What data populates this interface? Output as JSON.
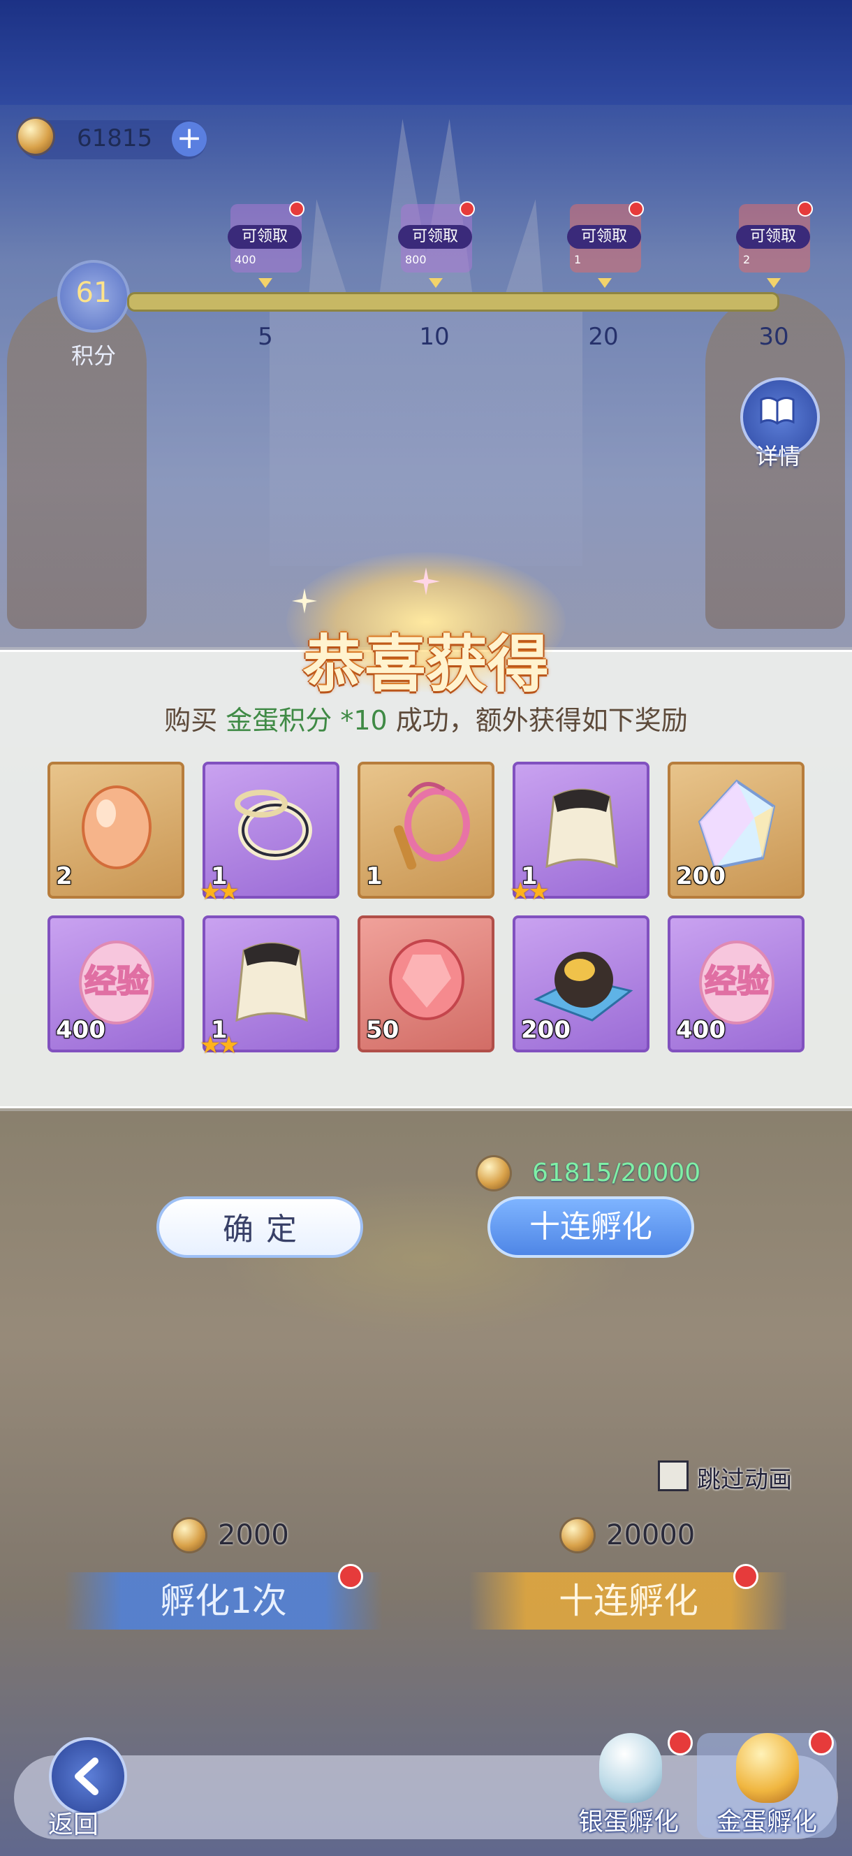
{
  "hud": {
    "gold_coin_balance": "61815",
    "add_label": "+",
    "points_value": "61",
    "points_label": "积分",
    "detail_label": "详情"
  },
  "milestones": [
    {
      "status": "可领取",
      "reward": "400",
      "threshold": "5"
    },
    {
      "status": "可领取",
      "reward": "800",
      "threshold": "10"
    },
    {
      "status": "可领取",
      "reward": "1",
      "threshold": "20"
    },
    {
      "status": "可领取",
      "reward": "2",
      "threshold": "30"
    }
  ],
  "popup": {
    "title": "恭喜获得",
    "msg_prefix": "购买 ",
    "msg_item": "金蛋积分 *10",
    "msg_suffix": " 成功，额外获得如下奖励",
    "rewards": [
      {
        "icon": "orange-egg-icon",
        "count": "2",
        "rarity": "gold",
        "stars": ""
      },
      {
        "icon": "bracelet-icon",
        "count": "1",
        "rarity": "purple",
        "stars": "★★"
      },
      {
        "icon": "whip-icon",
        "count": "1",
        "rarity": "gold",
        "stars": ""
      },
      {
        "icon": "cape-icon",
        "count": "1",
        "rarity": "purple",
        "stars": "★★"
      },
      {
        "icon": "crystal-icon",
        "count": "200",
        "rarity": "gold",
        "stars": ""
      },
      {
        "icon": "exp-egg-icon",
        "count": "400",
        "rarity": "purple",
        "stars": "",
        "text": "经验"
      },
      {
        "icon": "cape-icon",
        "count": "1",
        "rarity": "purple",
        "stars": "★★"
      },
      {
        "icon": "red-gem-icon",
        "count": "50",
        "rarity": "red",
        "stars": ""
      },
      {
        "icon": "gold-ore-icon",
        "count": "200",
        "rarity": "purple",
        "stars": ""
      },
      {
        "icon": "exp-egg-icon",
        "count": "400",
        "rarity": "purple",
        "stars": "",
        "text": "经验"
      }
    ]
  },
  "buttons": {
    "confirm": "确定",
    "ten_hatch": "十连孵化",
    "gold_need": "61815/20000"
  },
  "lower": {
    "skip_label": "跳过动画",
    "cost_single": "2000",
    "cost_ten": "20000",
    "hatch_single": "孵化1次",
    "hatch_ten": "十连孵化"
  },
  "bottom": {
    "back": "返回",
    "silver_tab": "银蛋孵化",
    "gold_tab": "金蛋孵化"
  },
  "colors": {
    "highlight_green": "#3f8a45",
    "reward_gold": "#c99653",
    "reward_purple": "#9b6cd6",
    "reward_red": "#d26d66",
    "badge_red": "#e63b3b"
  }
}
